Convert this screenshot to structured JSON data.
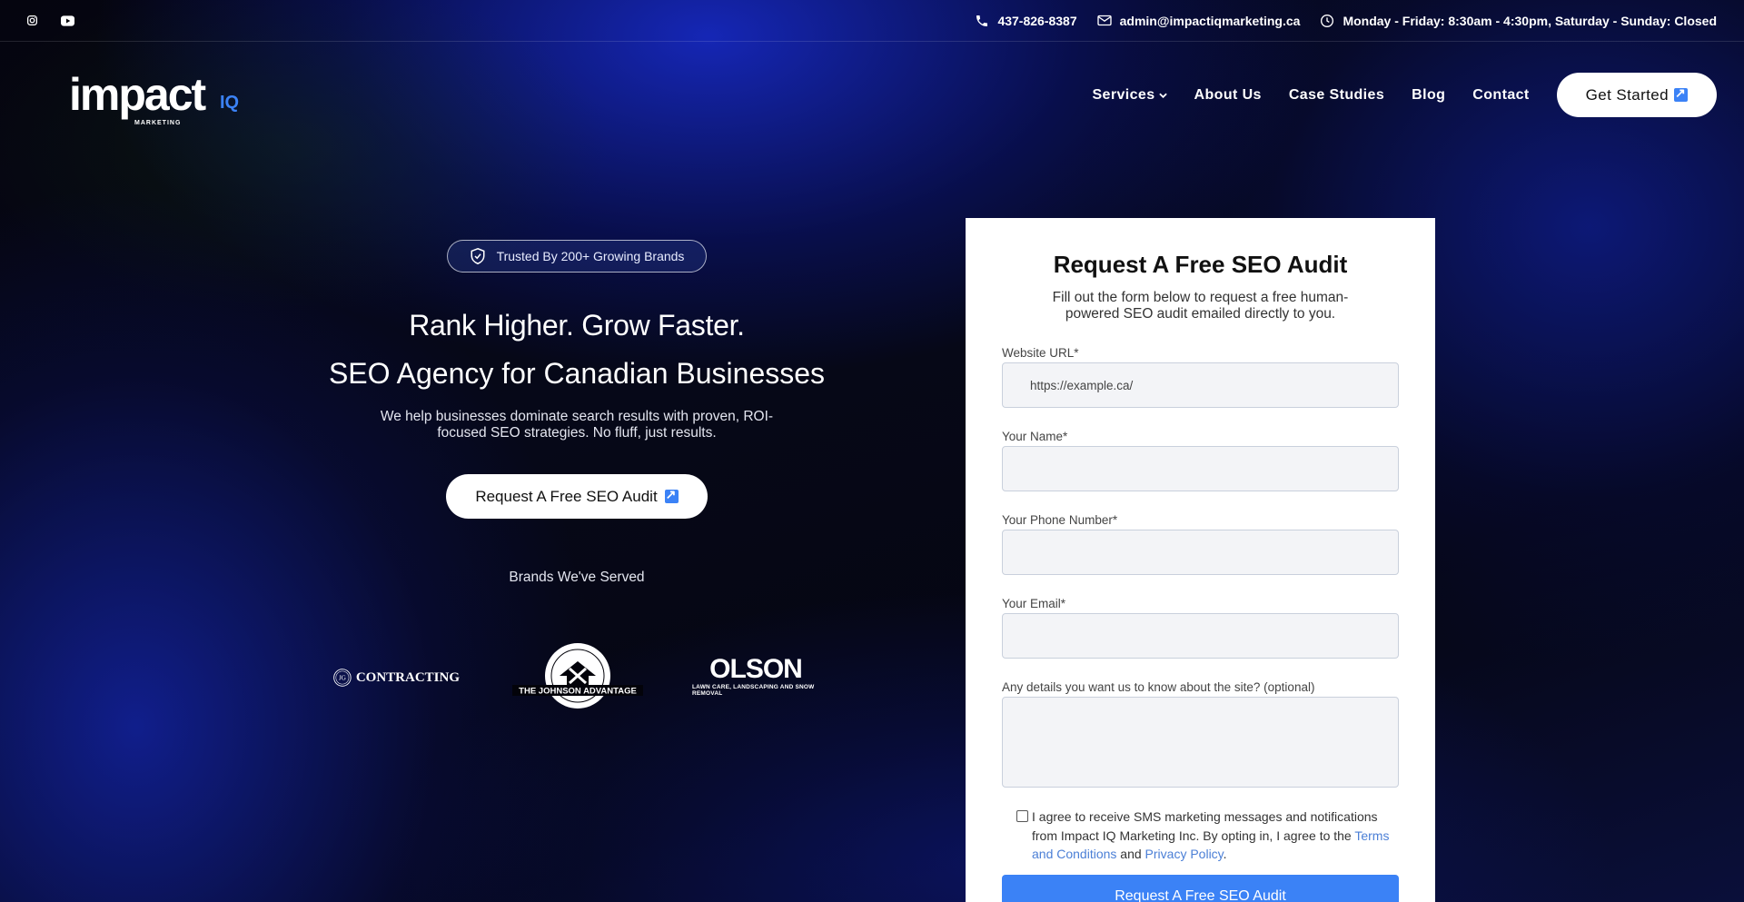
{
  "topbar": {
    "social": [
      {
        "icon": "instagram-icon"
      },
      {
        "icon": "youtube-icon"
      }
    ],
    "phone": "437-826-8387",
    "email": "admin@impactiqmarketing.ca",
    "hours": "Monday - Friday: 8:30am - 4:30pm, Saturday - Sunday: Closed"
  },
  "header": {
    "logo": {
      "word": "impact",
      "suffix": "IQ",
      "tagline": "MARKETING"
    },
    "nav": [
      {
        "label": "Services",
        "icon": "chevron-down-icon"
      },
      {
        "label": "About Us"
      },
      {
        "label": "Case Studies"
      },
      {
        "label": "Blog"
      },
      {
        "label": "Contact"
      }
    ],
    "cta_label": "Get Started"
  },
  "hero": {
    "badge": "Trusted By 200+ Growing Brands",
    "title": "Rank Higher. Grow Faster.",
    "subtitle": "SEO Agency for Canadian Businesses",
    "lead": "We help businesses dominate search results with proven, ROI-focused SEO strategies. No fluff, just results.",
    "cta_label": "Request A Free SEO Audit",
    "brands_title": "Brands We've Served",
    "brands": [
      {
        "mark": "JG",
        "name": "CONTRACTING"
      },
      {
        "name": "THE JOHNSON ADVANTAGE"
      },
      {
        "name": "OLSON",
        "tagline": "LAWN CARE, LANDSCAPING AND SNOW REMOVAL"
      }
    ]
  },
  "form": {
    "title": "Request A Free SEO Audit",
    "subtitle": "Fill out the form below to request a free human-powered SEO audit emailed directly to you.",
    "fields": [
      {
        "label": "Website URL*",
        "placeholder": "https://example.ca/"
      },
      {
        "label": "Your Name*",
        "placeholder": ""
      },
      {
        "label": "Your Phone Number*",
        "placeholder": ""
      },
      {
        "label": "Your Email*",
        "placeholder": ""
      },
      {
        "label": "Any details you want us to know about the site? (optional)",
        "placeholder": ""
      }
    ],
    "consent": {
      "text": "I agree to receive SMS marketing messages and notifications from Impact IQ Marketing Inc. By opting in, I agree to the",
      "terms": "Terms and Conditions",
      "and": "and",
      "privacy": "Privacy Policy",
      "end": "."
    },
    "submit_label": "Request A Free SEO Audit"
  },
  "colors": {
    "accent": "#3b82f6",
    "link": "#4b7fd6"
  }
}
